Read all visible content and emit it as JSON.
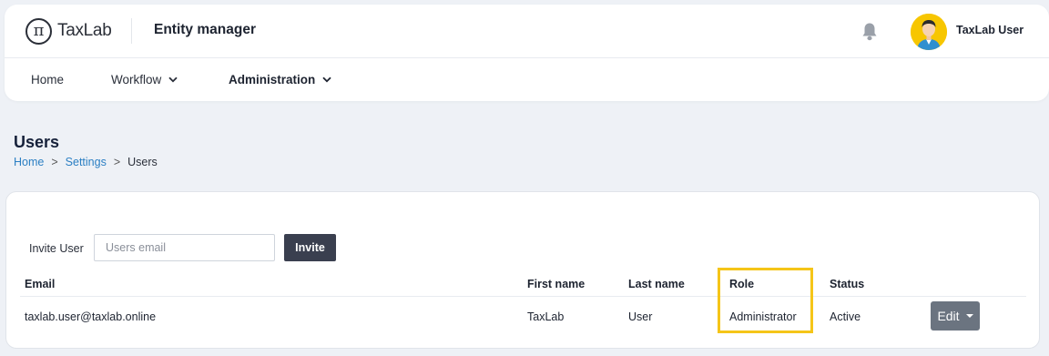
{
  "header": {
    "logo_text": "TaxLab",
    "logo_symbol": "π",
    "app_title": "Entity manager",
    "user_name": "TaxLab User",
    "icons": [
      "bell-icon",
      "user-avatar"
    ]
  },
  "nav": {
    "items": [
      {
        "label": "Home"
      },
      {
        "label": "Workflow"
      },
      {
        "label": "Administration"
      }
    ]
  },
  "page": {
    "title": "Users",
    "breadcrumb": [
      {
        "label": "Home"
      },
      {
        "label": "Settings"
      },
      {
        "label": "Users"
      }
    ],
    "breadcrumb_separator": ">"
  },
  "invite": {
    "label": "Invite User",
    "placeholder": "Users email",
    "value": "",
    "button_label": "Invite"
  },
  "table": {
    "columns": [
      "Email",
      "First name",
      "Last name",
      "Role",
      "Status"
    ],
    "rows": [
      {
        "email": "taxlab.user@taxlab.online",
        "first_name": "TaxLab",
        "last_name": "User",
        "role": "Administrator",
        "status": "Active",
        "action_label": "Edit"
      }
    ]
  },
  "colors": {
    "background": "#eef1f6",
    "link": "#2b7fc3",
    "primary_button": "#3a3f4f",
    "edit_button": "#6b7480",
    "highlight": "#f5c518",
    "avatar_bg": "#f7c600"
  }
}
